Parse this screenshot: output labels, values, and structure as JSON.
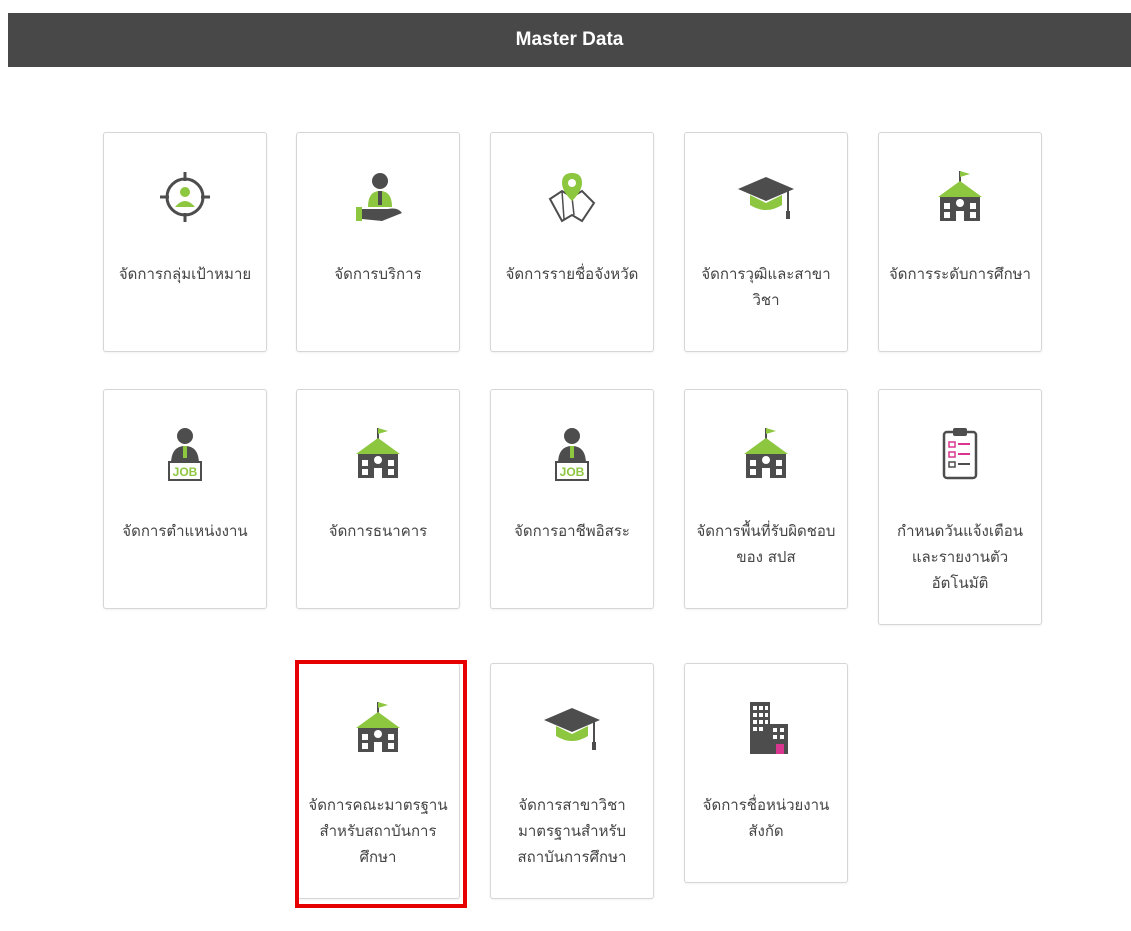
{
  "header": {
    "title": "Master Data"
  },
  "accent_color": "#8dc63f",
  "dark_color": "#4d4d4d",
  "highlight_color": "#e60000",
  "cards": [
    {
      "label": "จัดการกลุ่มเป้าหมาย",
      "icon": "target-user-icon"
    },
    {
      "label": "จัดการบริการ",
      "icon": "service-hand-icon"
    },
    {
      "label": "จัดการรายชื่อจังหวัด",
      "icon": "map-pin-icon"
    },
    {
      "label": "จัดการวุฒิและสาขาวิชา",
      "icon": "graduation-cap-icon"
    },
    {
      "label": "จัดการระดับการศึกษา",
      "icon": "school-building-icon"
    },
    {
      "label": "จัดการตำแหน่งงาน",
      "icon": "job-person-icon"
    },
    {
      "label": "จัดการธนาคาร",
      "icon": "school-building-icon"
    },
    {
      "label": "จัดการอาชีพอิสระ",
      "icon": "job-person-icon"
    },
    {
      "label": "จัดการพื้นที่รับผิดชอบของ สปส",
      "icon": "school-building-icon"
    },
    {
      "label": "กำหนดวันแจ้งเตือนและรายงานตัวอัตโนมัติ",
      "icon": "clipboard-checklist-icon"
    },
    {
      "label": "จัดการคณะมาตรฐานสำหรับสถาบันการศึกษา",
      "icon": "school-building-icon"
    },
    {
      "label": "จัดการสาขาวิชามาตรฐานสำหรับสถาบันการศึกษา",
      "icon": "graduation-cap-icon"
    },
    {
      "label": "จัดการชื่อหน่วยงานสังกัด",
      "icon": "office-building-icon"
    }
  ]
}
